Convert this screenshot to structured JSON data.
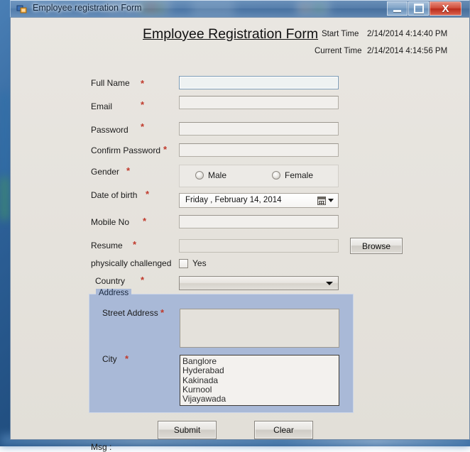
{
  "window": {
    "title": "Employee registration Form",
    "icon": "form-app-icon",
    "controls": {
      "minimize": "minimize-icon",
      "maximize": "maximize-icon",
      "close": "X"
    }
  },
  "header": {
    "form_title": "Employee Registration Form",
    "start_time_label": "Start Time",
    "start_time_value": "2/14/2014 4:14:40 PM",
    "current_time_label": "Current Time",
    "current_time_value": "2/14/2014 4:14:56 PM"
  },
  "fields": {
    "full_name": {
      "label": "Full Name",
      "required": "*",
      "value": "",
      "placeholder": ""
    },
    "email": {
      "label": "Email",
      "required": "*",
      "value": "",
      "placeholder": ""
    },
    "password": {
      "label": "Password",
      "required": "*",
      "value": "",
      "placeholder": ""
    },
    "confirm_password": {
      "label": "Confirm Password",
      "required": "*",
      "value": "",
      "placeholder": ""
    },
    "gender": {
      "label": "Gender",
      "required": "*",
      "options": [
        {
          "label": "Male",
          "selected": false
        },
        {
          "label": "Female",
          "selected": false
        }
      ]
    },
    "date_of_birth": {
      "label": "Date of birth",
      "required": "*",
      "value": "Friday    ,   February  14, 2014"
    },
    "mobile_no": {
      "label": "Mobile No",
      "required": "*",
      "value": "",
      "placeholder": ""
    },
    "resume": {
      "label": "Resume",
      "required": "*",
      "value": "",
      "placeholder": "",
      "browse_label": "Browse"
    },
    "physically_challenged": {
      "label": "physically challenged",
      "checkbox_label": "Yes",
      "checked": false
    },
    "country": {
      "label": "Country",
      "required": "*",
      "selected": "",
      "options": []
    }
  },
  "address": {
    "group_title": "Address",
    "street_label": "Street Address",
    "street_required": "*",
    "street_value": "",
    "city_label": "City",
    "city_required": "*",
    "cities": [
      "Banglore",
      "Hyderabad",
      "Kakinada",
      "Kurnool",
      "Vijayawada"
    ]
  },
  "actions": {
    "submit_label": "Submit",
    "clear_label": "Clear"
  },
  "status": {
    "msg_label": "Msg :",
    "msg_value": ""
  },
  "colors": {
    "form_background": "#e4e1db",
    "group_blue": "#a9b9d7",
    "required_red": "#c0392b",
    "title_bar": "#6f8db5",
    "close_button": "#cf4b38"
  }
}
